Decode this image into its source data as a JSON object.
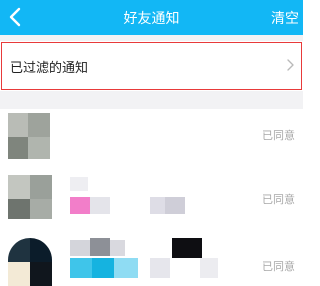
{
  "header": {
    "title": "好友通知",
    "clear_label": "清空",
    "bg_color": "#12b7f5"
  },
  "filtered": {
    "label": "已过滤的通知"
  },
  "notifications": [
    {
      "status": "已同意"
    },
    {
      "status": "已同意"
    },
    {
      "status": "已同意"
    }
  ]
}
